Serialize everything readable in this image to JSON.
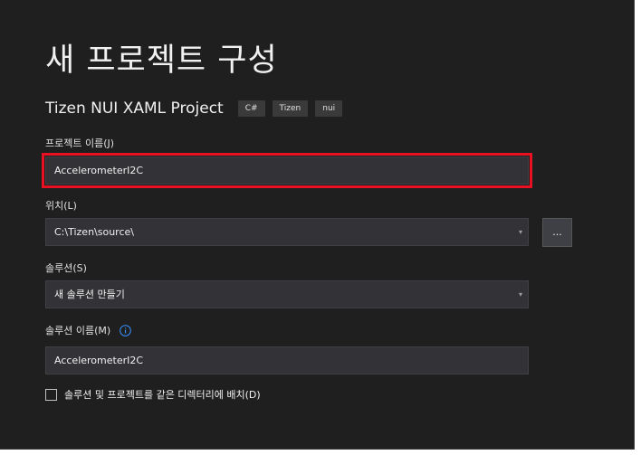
{
  "title": "새 프로젝트 구성",
  "project": {
    "name": "Tizen NUI XAML Project",
    "tags": [
      "C#",
      "Tizen",
      "nui"
    ]
  },
  "project_name": {
    "label": "프로젝트 이름(J)",
    "value": "AccelerometerI2C"
  },
  "location": {
    "label": "위치(L)",
    "value": "C:\\Tizen\\source\\",
    "browse_label": "..."
  },
  "solution": {
    "label": "솔루션(S)",
    "value": "새 솔루션 만들기"
  },
  "solution_name": {
    "label": "솔루션 이름(M)",
    "value": "AccelerometerI2C",
    "icon": "info-icon"
  },
  "same_directory": {
    "label": "솔루션 및 프로젝트를 같은 디렉터리에 배치(D)",
    "checked": false
  },
  "colors": {
    "background": "#1f1f1f",
    "field": "#333337",
    "highlight": "#e81123",
    "info": "#3794ff"
  }
}
